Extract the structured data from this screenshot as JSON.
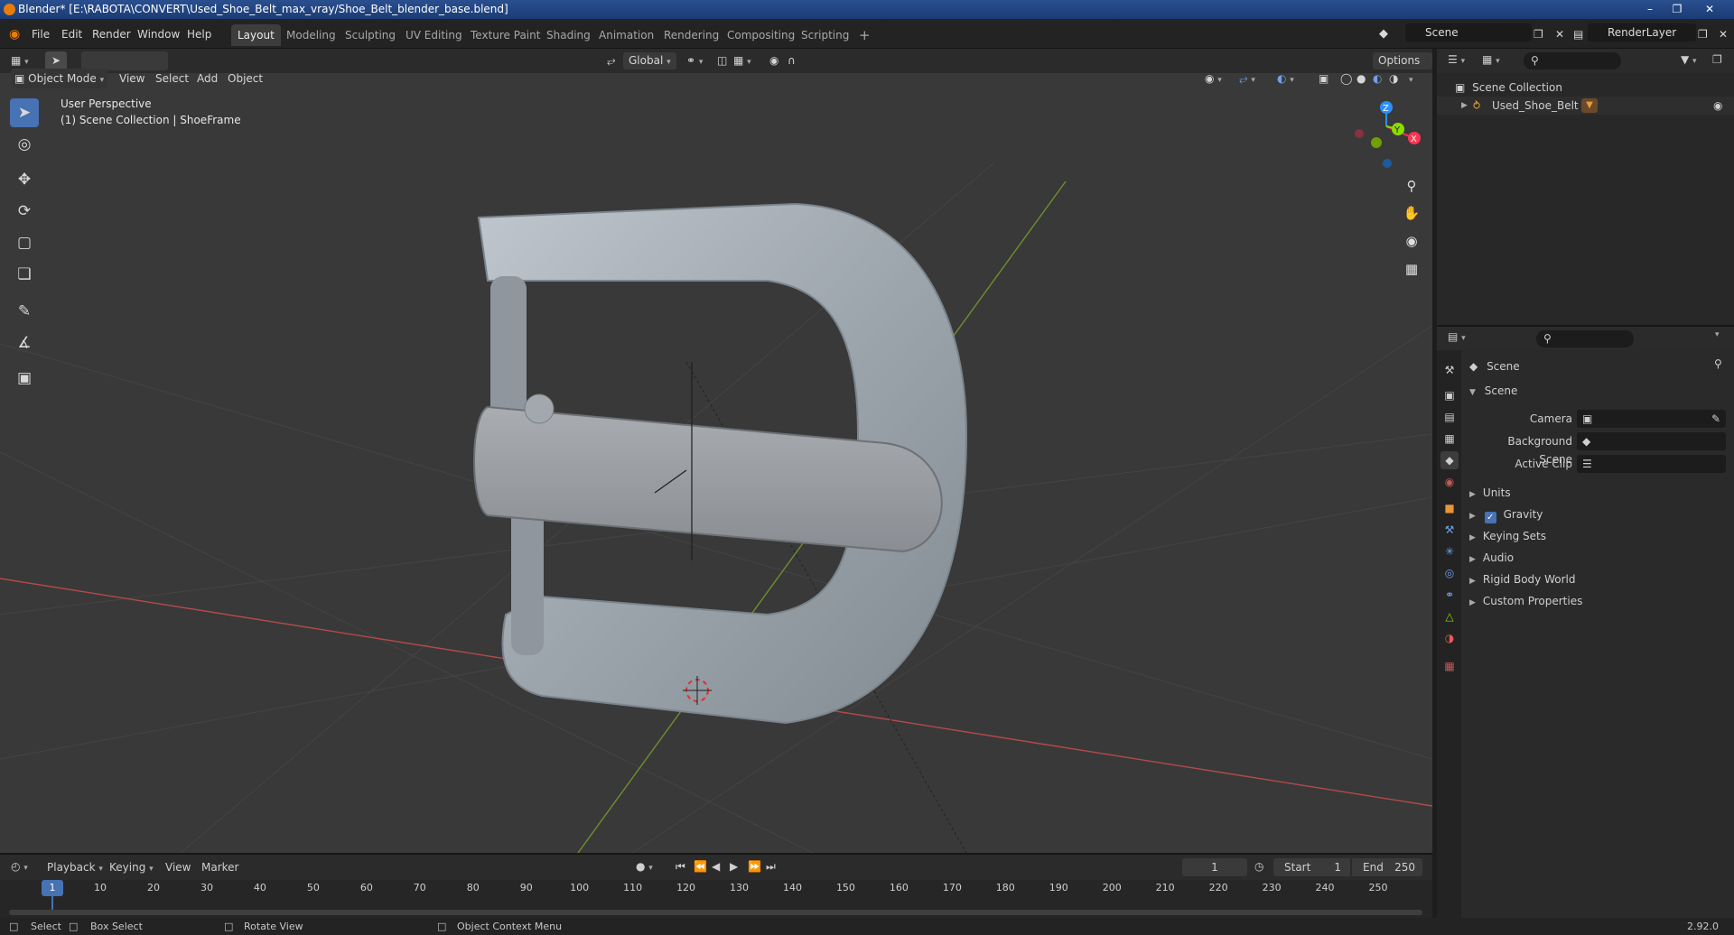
{
  "window": {
    "title": "Blender* [E:\\RABOTA\\CONVERT\\Used_Shoe_Belt_max_vray/Shoe_Belt_blender_base.blend]"
  },
  "menu": [
    "File",
    "Edit",
    "Render",
    "Window",
    "Help"
  ],
  "workspaces": [
    {
      "label": "Layout",
      "active": true
    },
    {
      "label": "Modeling"
    },
    {
      "label": "Sculpting"
    },
    {
      "label": "UV Editing"
    },
    {
      "label": "Texture Paint"
    },
    {
      "label": "Shading"
    },
    {
      "label": "Animation"
    },
    {
      "label": "Rendering"
    },
    {
      "label": "Compositing"
    },
    {
      "label": "Scripting"
    }
  ],
  "top_right": {
    "scene": "Scene",
    "render_layer": "RenderLayer"
  },
  "viewport_header": {
    "mode": "Object Mode",
    "menus": [
      "View",
      "Select",
      "Add",
      "Object"
    ],
    "transform_orientation": "Global",
    "options": "Options"
  },
  "viewport": {
    "perspective": "User Perspective",
    "collection_info": "(1) Scene Collection | ShoeFrame",
    "gizmo_axes": {
      "z": "Z",
      "y": "Y",
      "x": "X"
    }
  },
  "outliner": {
    "root": "Scene Collection",
    "items": [
      {
        "label": "Used_Shoe_Belt"
      }
    ]
  },
  "properties": {
    "context": "Scene",
    "panel": "Scene",
    "fields": [
      {
        "label": "Camera"
      },
      {
        "label": "Background Scene"
      },
      {
        "label": "Active Clip"
      }
    ],
    "subpanels": [
      "Units",
      "Gravity",
      "Keying Sets",
      "Audio",
      "Rigid Body World",
      "Custom Properties"
    ],
    "gravity_checked": true
  },
  "timeline": {
    "menus": [
      "Playback",
      "Keying",
      "View",
      "Marker"
    ],
    "current_frame": "1",
    "start_label": "Start",
    "start": "1",
    "end_label": "End",
    "end": "250",
    "ruler": [
      "1",
      "10",
      "20",
      "30",
      "40",
      "50",
      "60",
      "70",
      "80",
      "90",
      "100",
      "110",
      "120",
      "130",
      "140",
      "150",
      "160",
      "170",
      "180",
      "190",
      "200",
      "210",
      "220",
      "230",
      "240",
      "250"
    ]
  },
  "statusbar": {
    "select": "Select",
    "box_select": "Box Select",
    "rotate_view": "Rotate View",
    "context_menu": "Object Context Menu",
    "version": "2.92.0"
  },
  "colors": {
    "accent": "#4772b3",
    "axis_x": "#ff3352",
    "axis_y": "#8bdc00",
    "axis_z": "#2890ff",
    "title_bar": "#1e4280"
  }
}
